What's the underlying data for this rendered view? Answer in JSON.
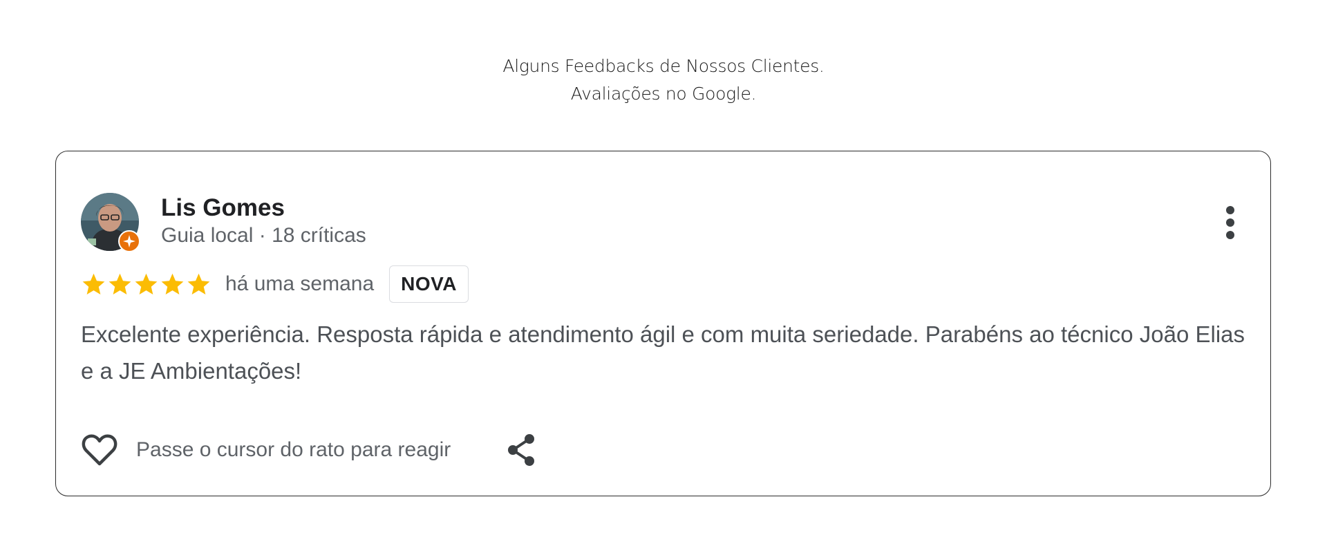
{
  "header": {
    "line1": "Alguns Feedbacks de Nossos Clientes.",
    "line2": "Avaliações no Google."
  },
  "review": {
    "author": "Lis Gomes",
    "author_meta": "Guia local · 18 críticas",
    "rating": 5,
    "rating_max": 5,
    "time": "há uma semana",
    "badge": "NOVA",
    "text": "Excelente experiência. Resposta rápida e atendimento ágil e com muita seriedade. Parabéns ao técnico João Elias e a JE Ambientações!",
    "react_label": "Passe o cursor do rato para reagir"
  },
  "icons": {
    "avatar": "user-photo",
    "local_guide_badge": "local-guide-badge-icon",
    "more": "more-vert-icon",
    "star": "star-icon",
    "heart": "heart-outline-icon",
    "share": "share-icon"
  },
  "colors": {
    "star": "#fbbc04",
    "badge": "#e8710a",
    "text_secondary": "#5f6368",
    "text_body": "#4d5156"
  }
}
